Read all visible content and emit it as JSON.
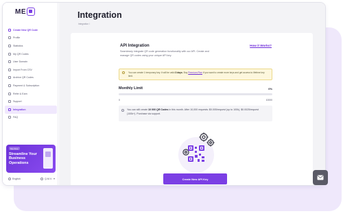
{
  "brand": {
    "logo_text": "ME",
    "logo_badge": "QR",
    "accent": "#7b3fe4"
  },
  "sidebar": {
    "items": [
      {
        "label": "Create New QR Code",
        "icon": "plus-icon"
      },
      {
        "label": "Profile",
        "icon": "user-icon"
      },
      {
        "label": "Statistics",
        "icon": "chart-icon"
      },
      {
        "label": "My QR Codes",
        "icon": "qr-icon"
      },
      {
        "label": "User Domain",
        "icon": "globe-icon"
      },
      {
        "label": "Import From CSV",
        "icon": "upload-icon"
      },
      {
        "label": "Archive QR Codes",
        "icon": "archive-icon"
      },
      {
        "label": "Payment & Subscription",
        "icon": "card-icon"
      },
      {
        "label": "Refer & Earn",
        "icon": "gift-icon"
      },
      {
        "label": "Support",
        "icon": "support-icon"
      },
      {
        "label": "Integration",
        "icon": "link-icon"
      },
      {
        "label": "FAQ",
        "icon": "help-icon"
      }
    ],
    "promo": {
      "tag": "Me-Flow",
      "title": "Streamline Your Business Operations"
    },
    "footer": {
      "language": "English",
      "account": "Q.M.V."
    }
  },
  "header": {
    "title": "Integration",
    "breadcrumb": "Integration /"
  },
  "api": {
    "title": "API Integration",
    "help_link": "How it Works?",
    "description": "Seamlessly integrate QR code generation functionality with our API. Create and manage QR codes using your unique API key."
  },
  "notice": {
    "pre": "You can create 1 temporary key. It will be valid ",
    "days": "3 days",
    "mid": ". Buy ",
    "link": "Premium Plan",
    "post": " if you want to create more keys and get access to lifetime key limit."
  },
  "limit": {
    "title": "Monthly Limit",
    "percent_label": "0%",
    "percent": 0,
    "min_label": "0",
    "max_label": "10000"
  },
  "pricing": {
    "pre": "You can still create ",
    "count": "10 000 QR Codes",
    "post": " in this month. After 10,000 requests: $0.005/request (up to 100k), $0.0025/request (100k+). Purchase via support."
  },
  "actions": {
    "create_key_label": "Create New API Key"
  }
}
